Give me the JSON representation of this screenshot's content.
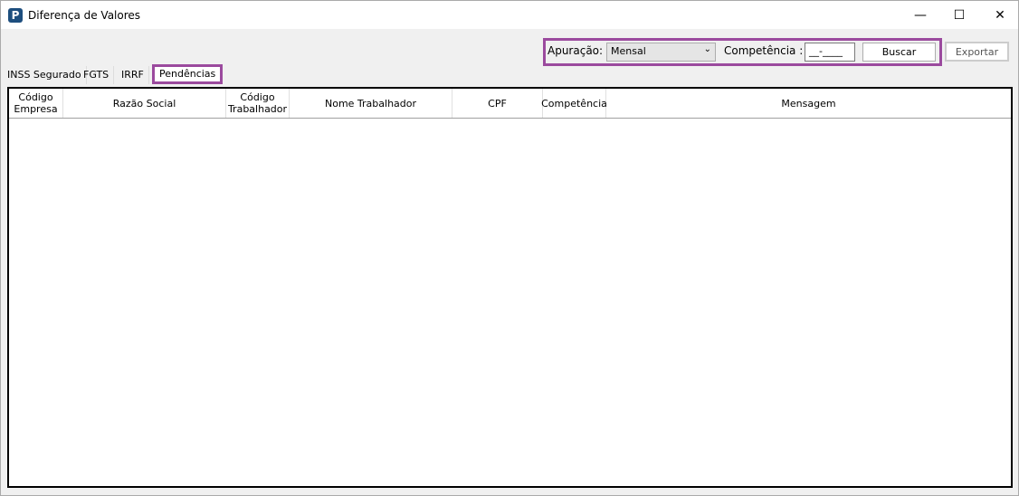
{
  "window": {
    "title": "Diferença de Valores",
    "logo": "P",
    "controls": [
      "minimize-icon",
      "maximize-icon",
      "close-icon"
    ]
  },
  "toolbar": {
    "apuracao_label": "Apuração:",
    "apuracao_value": "Mensal",
    "competencia_label": "Competência :",
    "competencia_value": "__-____",
    "buscar": "Buscar",
    "exportar": "Exportar"
  },
  "tabs": [
    {
      "label": "INSS Segurado"
    },
    {
      "label": "FGTS"
    },
    {
      "label": "IRRF"
    },
    {
      "label": "Pendências",
      "active": true
    }
  ],
  "grid": {
    "columns": [
      "Código Empresa",
      "Razão Social",
      "Código Trabalhador",
      "Nome Trabalhador",
      "CPF",
      "Competência",
      "Mensagem"
    ],
    "rows": []
  },
  "colors": {
    "highlight": "#9b4a9e"
  }
}
